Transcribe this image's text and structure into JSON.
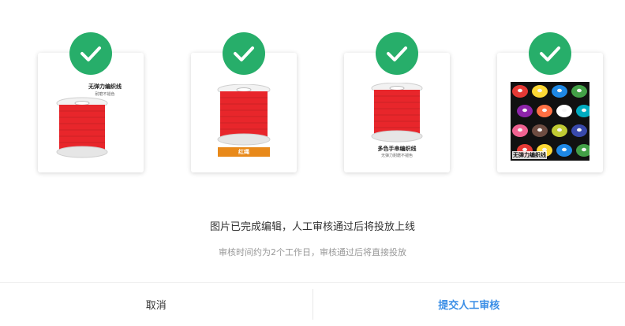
{
  "colors": {
    "check_green": "#27ae6a",
    "spool_red": "#e8262b",
    "tag_orange": "#e8891a",
    "submit_blue": "#3a8ee6",
    "cancel_text": "#333333"
  },
  "cards": [
    {
      "caption_title": "无弹力编织线",
      "caption_sub": "耐磨不褪色",
      "status_icon": "check-icon"
    },
    {
      "tag_label": "红绳",
      "status_icon": "check-icon"
    },
    {
      "caption_title": "多色手串编织线",
      "caption_sub": "无弹力耐磨不褪色",
      "status_icon": "check-icon"
    },
    {
      "caption_title": "无弹力编织线",
      "status_icon": "check-icon"
    }
  ],
  "message": "图片已完成编辑，人工审核通过后将投放上线",
  "sub_message": "审核时间约为2个工作日，审核通过后将直接投放",
  "footer": {
    "cancel_label": "取消",
    "submit_label": "提交人工审核"
  }
}
